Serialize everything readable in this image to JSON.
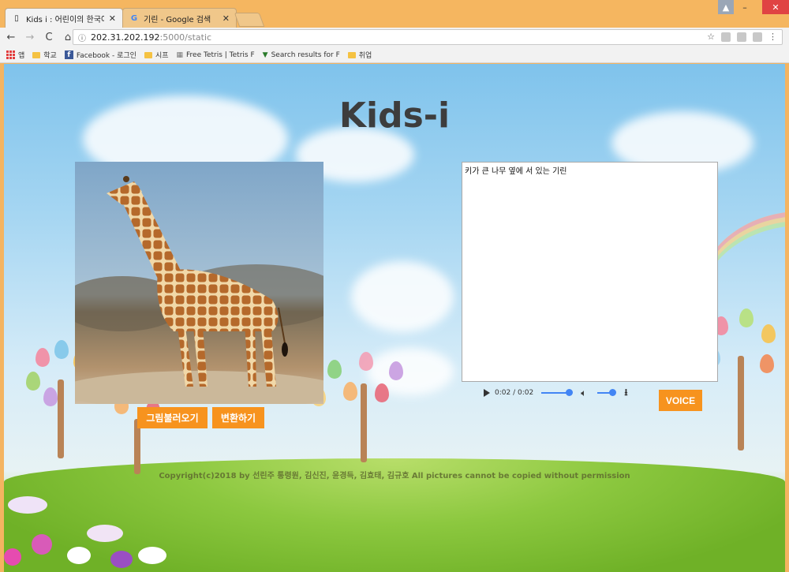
{
  "browser": {
    "tabs": [
      {
        "title": "Kids i : 어린이의 한국어",
        "icon": "page-icon",
        "active": true
      },
      {
        "title": "기린 - Google 검색",
        "icon": "google-icon",
        "active": false
      }
    ],
    "url_host": "202.31.202.192",
    "url_path": ":5000/static",
    "bookmarks": [
      {
        "label": "앱",
        "icon": "apps-icon"
      },
      {
        "label": "학교",
        "icon": "folder-icon"
      },
      {
        "label": "Facebook - 로그인",
        "icon": "facebook-icon"
      },
      {
        "label": "시프",
        "icon": "folder-icon"
      },
      {
        "label": "Free Tetris | Tetris F",
        "icon": "tetris-icon"
      },
      {
        "label": "Search results for F",
        "icon": "search-results-icon"
      },
      {
        "label": "취업",
        "icon": "folder-icon"
      }
    ]
  },
  "page": {
    "title": "Kids-i",
    "load_button": "그림불러오기",
    "convert_button": "변환하기",
    "result_text": "키가 큰 나무 옆에 서 있는 기린",
    "audio_time": "0:02 / 0:02",
    "voice_button": "VOICE",
    "copyright": "Copyright(c)2018 by 선린주 통령원, 김신진, 윤경득, 김효태, 김규호 All pictures cannot be copied without permission"
  },
  "colors": {
    "accent": "#f7931e",
    "chrome": "#f5b660",
    "title": "#3d3d3d"
  }
}
